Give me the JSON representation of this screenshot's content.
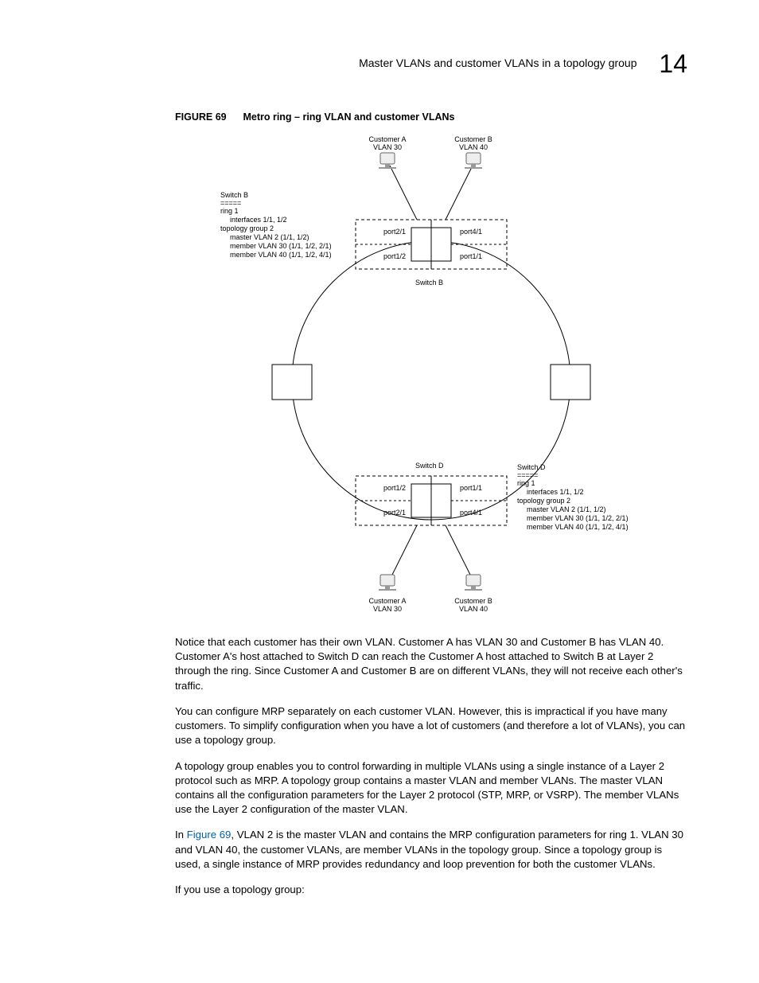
{
  "header": {
    "title": "Master VLANs and customer VLANs in a topology group",
    "chapter": "14"
  },
  "figure": {
    "label": "FIGURE 69",
    "title": "Metro ring – ring VLAN and customer VLANs"
  },
  "diagram": {
    "top": {
      "custA_line1": "Customer A",
      "custA_line2": "VLAN 30",
      "custB_line1": "Customer B",
      "custB_line2": "VLAN 40",
      "port21": "port2/1",
      "port41": "port4/1",
      "port12": "port1/2",
      "port11": "port1/1",
      "switch_label": "Switch B",
      "cfg_title": "Switch B",
      "cfg_equals": "=====",
      "cfg_ring": "ring 1",
      "cfg_if": "interfaces 1/1, 1/2",
      "cfg_topo": "topology group 2",
      "cfg_master": "master VLAN 2 (1/1, 1/2)",
      "cfg_m30": "member VLAN 30 (1/1, 1/2, 2/1)",
      "cfg_m40": "member VLAN 40 (1/1, 1/2, 4/1)"
    },
    "bottom": {
      "switch_label": "Switch D",
      "port12": "port1/2",
      "port11": "port1/1",
      "port21": "port2/1",
      "port41": "port4/1",
      "custA_line1": "Customer A",
      "custA_line2": "VLAN 30",
      "custB_line1": "Customer B",
      "custB_line2": "VLAN 40",
      "cfg_title": "Switch D",
      "cfg_equals": "=====",
      "cfg_ring": "ring 1",
      "cfg_if": "interfaces 1/1, 1/2",
      "cfg_topo": "topology group 2",
      "cfg_master": "master VLAN 2 (1/1, 1/2)",
      "cfg_m30": "member VLAN 30 (1/1, 1/2, 2/1)",
      "cfg_m40": "member VLAN 40 (1/1, 1/2, 4/1)"
    }
  },
  "paras": {
    "p1": "Notice that each customer has their own VLAN.  Customer A has VLAN 30 and Customer B has VLAN 40.  Customer A's host attached to Switch D can reach the Customer A host attached to Switch B at Layer 2 through the ring.  Since Customer A and Customer B are on different VLANs, they will not receive each other's traffic.",
    "p2": "You can configure MRP separately on each customer VLAN.  However, this is impractical if you have many customers.  To simplify configuration when you have a lot of customers (and therefore a lot of VLANs), you can use a topology group.",
    "p3": "A topology group enables you to control forwarding in multiple VLANs using a single instance of a Layer 2 protocol such as MRP.  A topology group contains a master VLAN and member VLANs.  The master VLAN contains all the configuration parameters for the Layer 2 protocol (STP, MRP, or VSRP).  The member VLANs use the Layer 2 configuration of the master VLAN.",
    "p4_pre": "In ",
    "p4_link": "Figure 69",
    "p4_post": ", VLAN 2 is the master VLAN and contains the MRP configuration parameters for ring 1.  VLAN 30 and VLAN 40, the customer VLANs, are member VLANs in the topology group. Since a topology group is used, a single instance of MRP provides redundancy and loop prevention for both the customer VLANs.",
    "p5": "If you use a topology group:"
  }
}
